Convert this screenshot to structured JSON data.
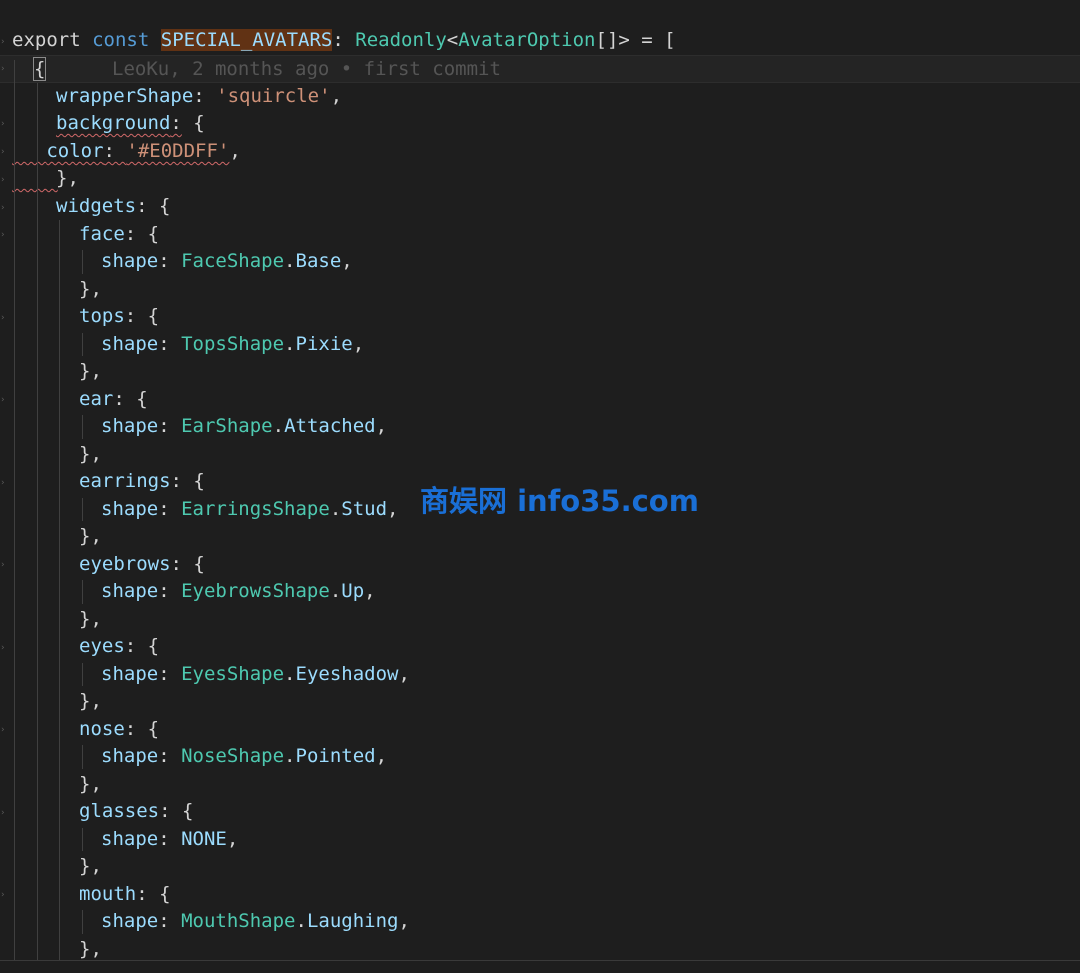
{
  "editor": {
    "line1": {
      "export": "export",
      "const": "const",
      "name": "SPECIAL_AVATARS",
      "colon": ":",
      "readonly": "Readonly",
      "lt": "<",
      "avatar_option": "AvatarOption",
      "tail": "[]> = ["
    },
    "line2": {
      "brace": "{",
      "blame": "LeoKu, 2 months ago • first commit"
    },
    "wrapper": {
      "key": "wrapperShape",
      "colon": ": ",
      "value": "'squircle'",
      "comma": ","
    },
    "background": {
      "key": "background",
      "colon": ":",
      "open": " {"
    },
    "color": {
      "key": "color",
      "colon": ": ",
      "value": "'#E0DDFF'",
      "comma": ","
    },
    "bg_close": "},",
    "widgets": {
      "key": "widgets",
      "rest": ": {"
    },
    "items": [
      {
        "key": "face",
        "type": "FaceShape",
        "member": "Base"
      },
      {
        "key": "tops",
        "type": "TopsShape",
        "member": "Pixie"
      },
      {
        "key": "ear",
        "type": "EarShape",
        "member": "Attached"
      },
      {
        "key": "earrings",
        "type": "EarringsShape",
        "member": "Stud"
      },
      {
        "key": "eyebrows",
        "type": "EyebrowsShape",
        "member": "Up"
      },
      {
        "key": "eyes",
        "type": "EyesShape",
        "member": "Eyeshadow"
      },
      {
        "key": "nose",
        "type": "NoseShape",
        "member": "Pointed"
      },
      {
        "key": "glasses",
        "type": "",
        "member": "NONE"
      },
      {
        "key": "mouth",
        "type": "MouthShape",
        "member": "Laughing"
      }
    ],
    "shape_key": "shape",
    "close": "},"
  },
  "watermark": "商娱网 info35.com"
}
